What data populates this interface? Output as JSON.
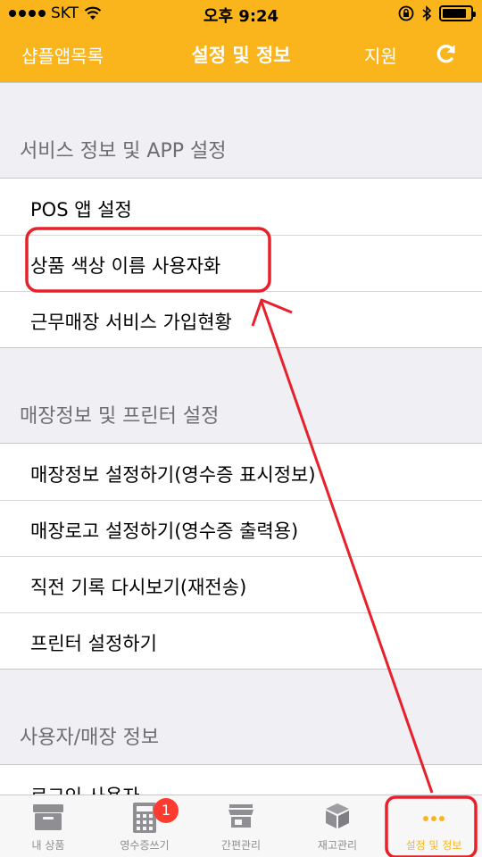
{
  "status_bar": {
    "carrier": "SKT",
    "time": "오후 9:24",
    "battery_level": 0.85
  },
  "nav": {
    "back_label": "샵플앱목록",
    "title": "설정 및 정보",
    "support_label": "지원"
  },
  "sections": [
    {
      "header": "서비스 정보 및 APP 설정",
      "rows": [
        "POS 앱 설정",
        "상품 색상 이름 사용자화",
        "근무매장 서비스 가입현황"
      ]
    },
    {
      "header": "매장정보 및 프린터 설정",
      "rows": [
        "매장정보 설정하기(영수증 표시정보)",
        "매장로고 설정하기(영수증 출력용)",
        "직전 기록 다시보기(재전송)",
        "프린터 설정하기"
      ]
    },
    {
      "header": "사용자/매장 정보",
      "rows": [
        "로그인 사용자"
      ]
    }
  ],
  "tabs": [
    {
      "label": "내 상품",
      "icon": "archive-box-icon"
    },
    {
      "label": "영수증쓰기",
      "icon": "calculator-icon",
      "badge": "1"
    },
    {
      "label": "간편관리",
      "icon": "store-icon"
    },
    {
      "label": "재고관리",
      "icon": "cube-icon"
    },
    {
      "label": "설정 및 정보",
      "icon": "more-dots-icon",
      "active": true
    }
  ],
  "colors": {
    "accent": "#fbb51c",
    "annotation": "#e8202a",
    "badge": "#ff3b30"
  }
}
